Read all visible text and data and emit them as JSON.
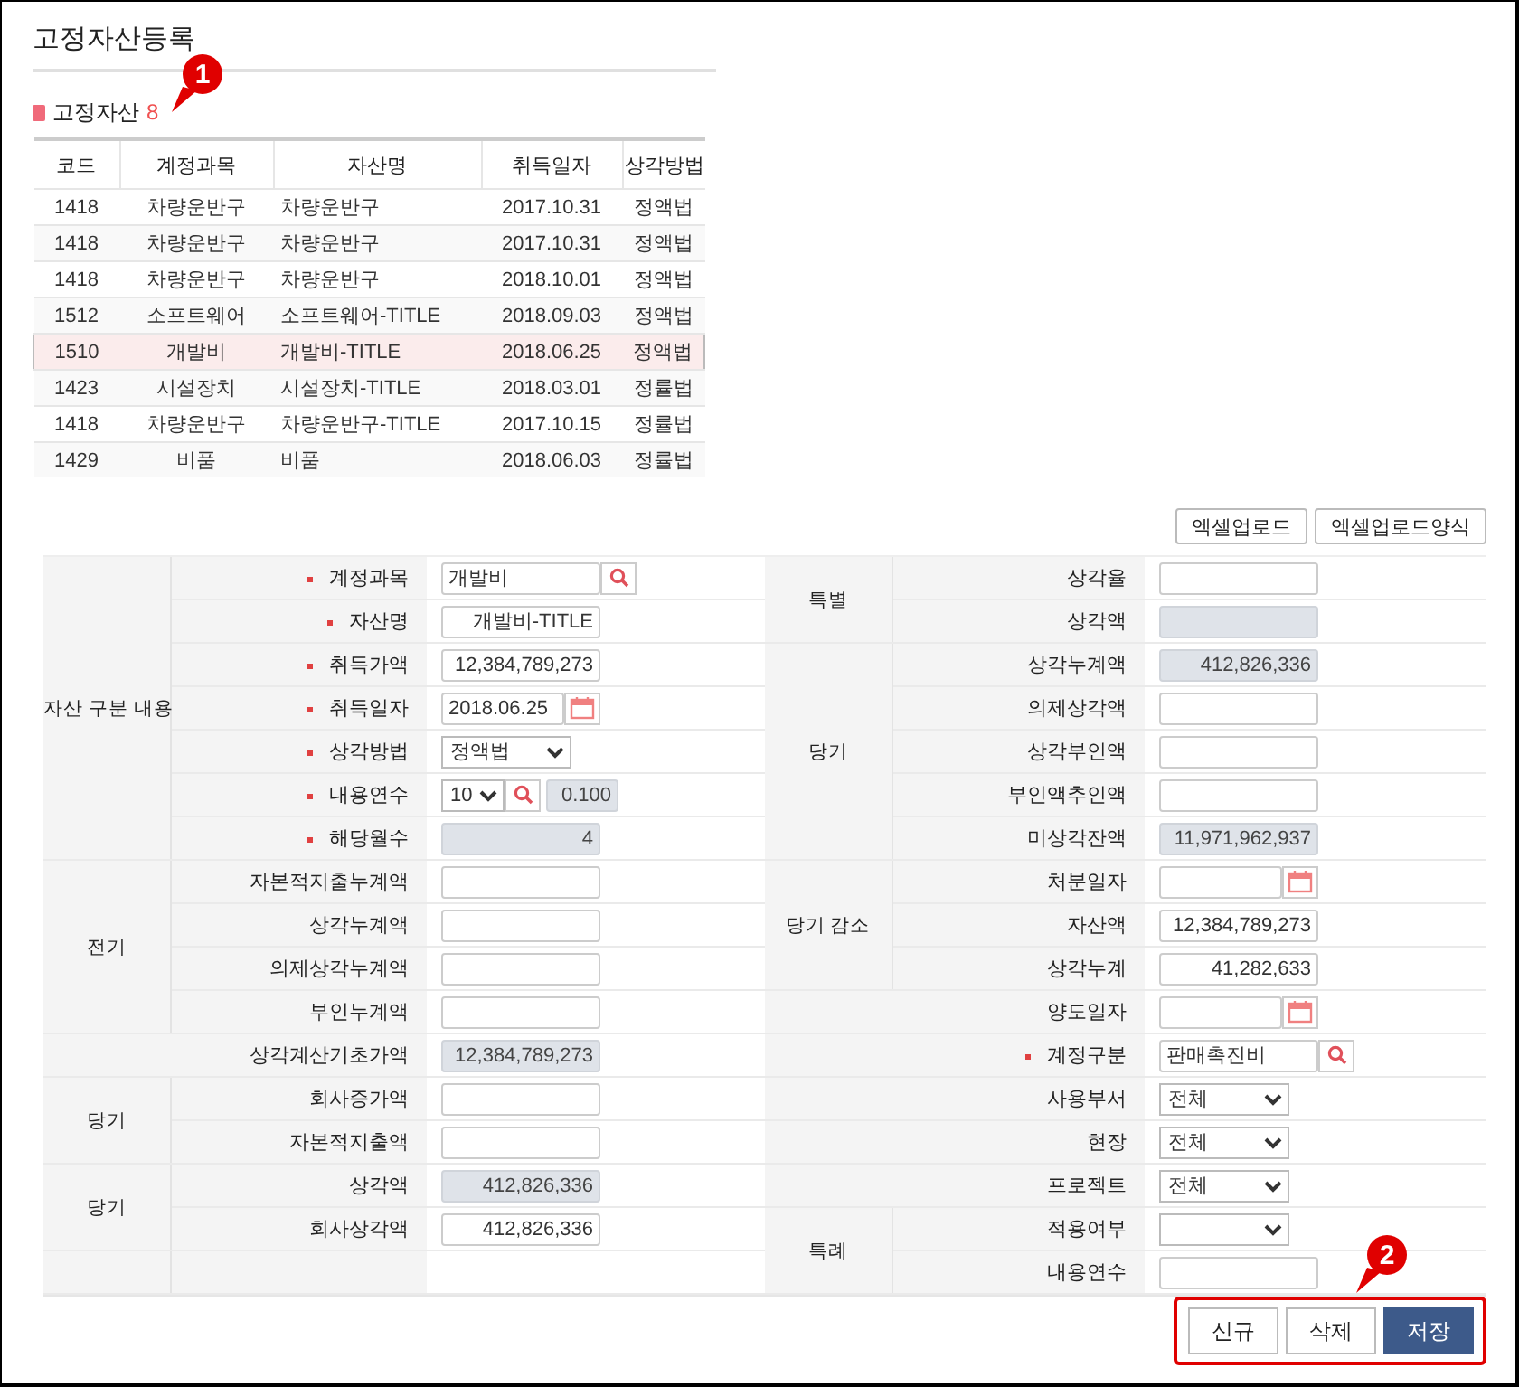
{
  "page_title": "고정자산등록",
  "asset_list": {
    "title": "고정자산",
    "count": "8",
    "callout": "1",
    "columns": [
      "코드",
      "계정과목",
      "자산명",
      "취득일자",
      "상각방법"
    ],
    "rows": [
      {
        "cells": [
          "1418",
          "차량운반구",
          "차량운반구",
          "2017.10.31",
          "정액법"
        ],
        "selected": false
      },
      {
        "cells": [
          "1418",
          "차량운반구",
          "차량운반구",
          "2017.10.31",
          "정액법"
        ],
        "selected": false
      },
      {
        "cells": [
          "1418",
          "차량운반구",
          "차량운반구",
          "2018.10.01",
          "정액법"
        ],
        "selected": false
      },
      {
        "cells": [
          "1512",
          "소프트웨어",
          "소프트웨어-TITLE",
          "2018.09.03",
          "정액법"
        ],
        "selected": false
      },
      {
        "cells": [
          "1510",
          "개발비",
          "개발비-TITLE",
          "2018.06.25",
          "정액법"
        ],
        "selected": true
      },
      {
        "cells": [
          "1423",
          "시설장치",
          "시설장치-TITLE",
          "2018.03.01",
          "정률법"
        ],
        "selected": false
      },
      {
        "cells": [
          "1418",
          "차량운반구",
          "차량운반구-TITLE",
          "2017.10.15",
          "정률법"
        ],
        "selected": false
      },
      {
        "cells": [
          "1429",
          "비품",
          "비품",
          "2018.06.03",
          "정률법"
        ],
        "selected": false
      }
    ]
  },
  "excel_buttons": [
    "엑셀업로드",
    "엑셀업로드양식"
  ],
  "form": {
    "left": [
      {
        "label": "자산 구분 내용",
        "rows": [
          {
            "label": "계정과목",
            "required": true,
            "field": {
              "kind": "search",
              "value": "개발비"
            }
          },
          {
            "label": "자산명",
            "required": true,
            "field": {
              "kind": "text",
              "value": "개발비-TITLE",
              "readonly": false
            }
          },
          {
            "label": "취득가액",
            "required": true,
            "field": {
              "kind": "text",
              "value": "12,384,789,273",
              "readonly": false
            }
          },
          {
            "label": "취득일자",
            "required": true,
            "field": {
              "kind": "date",
              "value": "2018.06.25"
            }
          },
          {
            "label": "상각방법",
            "required": true,
            "field": {
              "kind": "select",
              "value": "정액법"
            }
          },
          {
            "label": "내용연수",
            "required": true,
            "field": {
              "kind": "years",
              "value": "10",
              "rate": "0.100"
            }
          },
          {
            "label": "해당월수",
            "required": true,
            "field": {
              "kind": "text",
              "value": "4",
              "readonly": true
            }
          }
        ]
      },
      {
        "label": "전기",
        "rows": [
          {
            "label": "자본적지출누계액",
            "required": false,
            "field": {
              "kind": "text",
              "readonly": false
            }
          },
          {
            "label": "상각누계액",
            "required": false,
            "field": {
              "kind": "text",
              "readonly": false
            }
          },
          {
            "label": "의제상각누계액",
            "required": false,
            "field": {
              "kind": "text",
              "readonly": false
            }
          },
          {
            "label": "부인누계액",
            "required": false,
            "field": {
              "kind": "text",
              "readonly": false
            }
          }
        ]
      },
      {
        "rows": [
          {
            "label": "상각계산기초가액",
            "required": false,
            "field": {
              "kind": "text",
              "value": "12,384,789,273",
              "readonly": true
            }
          }
        ]
      },
      {
        "label": "당기",
        "rows": [
          {
            "label": "회사증가액",
            "required": false,
            "field": {
              "kind": "text",
              "readonly": false
            }
          },
          {
            "label": "자본적지출액",
            "required": false,
            "field": {
              "kind": "text",
              "readonly": false
            }
          }
        ]
      },
      {
        "label": "당기",
        "rows": [
          {
            "label": "상각액",
            "required": false,
            "field": {
              "kind": "text",
              "value": "412,826,336",
              "readonly": true
            }
          },
          {
            "label": "회사상각액",
            "required": false,
            "field": {
              "kind": "text",
              "value": "412,826,336",
              "readonly": false
            }
          }
        ]
      }
    ],
    "right": [
      {
        "label": "특별",
        "rows": [
          {
            "label": "상각율",
            "required": false,
            "field": {
              "kind": "text",
              "readonly": false
            }
          },
          {
            "label": "상각액",
            "required": false,
            "field": {
              "kind": "text",
              "readonly": true
            }
          }
        ]
      },
      {
        "label": "당기",
        "rows": [
          {
            "label": "상각누계액",
            "required": false,
            "field": {
              "kind": "text",
              "value": "412,826,336",
              "readonly": true
            }
          },
          {
            "label": "의제상각액",
            "required": false,
            "field": {
              "kind": "text",
              "readonly": false
            }
          },
          {
            "label": "상각부인액",
            "required": false,
            "field": {
              "kind": "text",
              "readonly": false
            }
          },
          {
            "label": "부인액추인액",
            "required": false,
            "field": {
              "kind": "text",
              "readonly": false
            }
          },
          {
            "label": "미상각잔액",
            "required": false,
            "field": {
              "kind": "text",
              "value": "11,971,962,937",
              "readonly": true
            }
          }
        ]
      },
      {
        "label": "당기 감소",
        "rows": [
          {
            "label": "처분일자",
            "required": false,
            "field": {
              "kind": "date"
            }
          },
          {
            "label": "자산액",
            "required": false,
            "field": {
              "kind": "text",
              "value": "12,384,789,273",
              "readonly": false
            }
          },
          {
            "label": "상각누계",
            "required": false,
            "field": {
              "kind": "text",
              "value": "41,282,633",
              "readonly": false
            }
          }
        ]
      },
      {
        "rows": [
          {
            "label": "양도일자",
            "required": false,
            "field": {
              "kind": "date"
            }
          },
          {
            "label": "계정구분",
            "required": true,
            "field": {
              "kind": "search",
              "value": "판매촉진비"
            }
          },
          {
            "label": "사용부서",
            "required": false,
            "field": {
              "kind": "select",
              "value": "전체"
            }
          },
          {
            "label": "현장",
            "required": false,
            "field": {
              "kind": "select",
              "value": "전체"
            }
          },
          {
            "label": "프로젝트",
            "required": false,
            "field": {
              "kind": "select",
              "value": "전체"
            }
          }
        ]
      },
      {
        "label": "특례",
        "rows": [
          {
            "label": "적용여부",
            "required": false,
            "field": {
              "kind": "select"
            }
          },
          {
            "label": "내용연수",
            "required": false,
            "field": {
              "kind": "text",
              "readonly": false
            }
          }
        ]
      }
    ]
  },
  "action_buttons": [
    {
      "label": "신규",
      "primary": false
    },
    {
      "label": "삭제",
      "primary": false
    },
    {
      "label": "저장",
      "primary": true
    }
  ],
  "action_callout": "2"
}
